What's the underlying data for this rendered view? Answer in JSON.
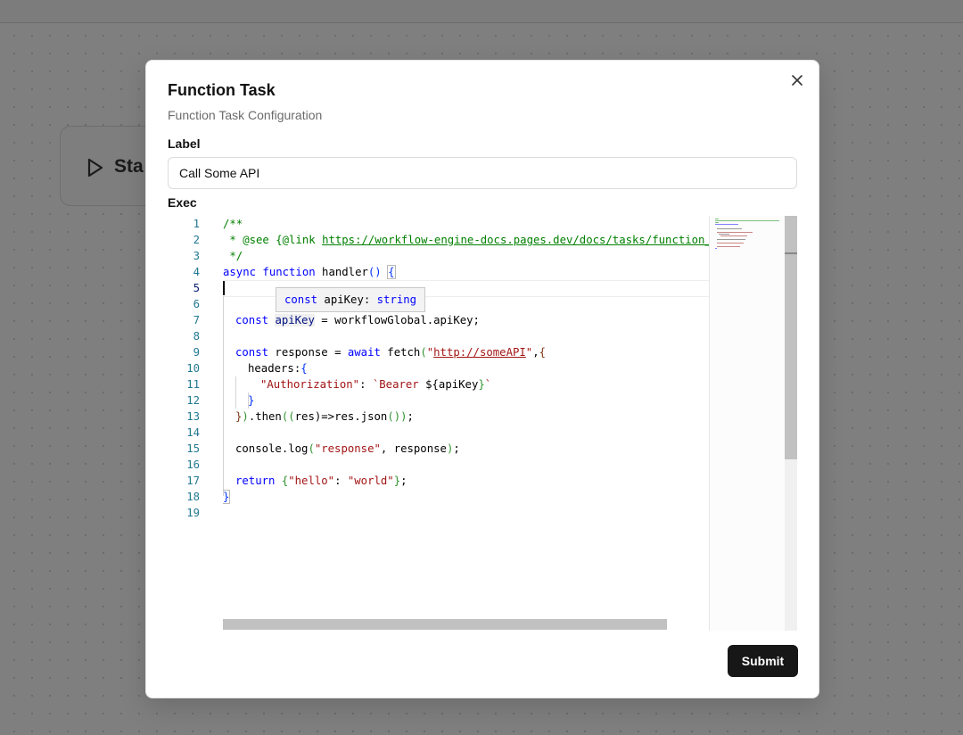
{
  "background_node": {
    "label": "Sta",
    "icon": "play-icon"
  },
  "dialog": {
    "title": "Function Task",
    "description": "Function Task Configuration",
    "label_field": {
      "label": "Label",
      "value": "Call Some API"
    },
    "exec_field": {
      "label": "Exec"
    },
    "submit_label": "Submit",
    "close_icon": "close-icon"
  },
  "editor": {
    "line_numbers": [
      "1",
      "2",
      "3",
      "4",
      "5",
      "6",
      "7",
      "8",
      "9",
      "10",
      "11",
      "12",
      "13",
      "14",
      "15",
      "16",
      "17",
      "18",
      "19"
    ],
    "active_line": "5",
    "hover_hint": {
      "prefix": "const ",
      "name": "apiKey",
      "sep": ": ",
      "type": "string"
    },
    "code": {
      "l1": "/**",
      "l2_a": " * @see {@link ",
      "l2_url": "https://workflow-engine-docs.pages.dev/docs/tasks/function_task",
      "l3": " */",
      "l4_kw": "async function",
      "l4_rest": " handler",
      "l4_paren": "()",
      "l4_brace": "{",
      "l7_kw": "const",
      "l7_var": "apiKey",
      "l7_rest": " = workflowGlobal.apiKey;",
      "l9_kw": "const",
      "l9_rest": " response = ",
      "l9_kw2": "await",
      "l9_fetch": " fetch",
      "l9_paren": "(",
      "l9_q1": "\"",
      "l9_url": "http://someAPI",
      "l9_q2": "\"",
      "l9_end": ",",
      "l9_brace": "{",
      "l10": "headers:",
      "l10_brace": "{",
      "l11_key": "\"Authorization\"",
      "l11_colon": ": ",
      "l11_tpl_a": "`Bearer ",
      "l11_dollar": "${",
      "l11_var": "apiKey",
      "l11_close": "}",
      "l11_tpl_b": "`",
      "l12_brace": "}",
      "l13_a": "}",
      "l13_b": ")",
      "l13_c": ".then",
      "l13_d": "((",
      "l13_e": "res",
      "l13_f": ")=>res.json",
      "l13_g": "())",
      "l13_h": ";",
      "l15_a": "console.log",
      "l15_b": "(",
      "l15_str": "\"response\"",
      "l15_c": ", response",
      "l15_d": ")",
      "l15_e": ";",
      "l17_kw": "return",
      "l17_brace": "{",
      "l17_k": "\"hello\"",
      "l17_colon": ": ",
      "l17_v": "\"world\"",
      "l17_close": "}",
      "l17_semi": ";",
      "l18": "}"
    }
  },
  "colors": {
    "primary_button": "#171717",
    "comment": "#008000",
    "keyword": "#0000ff",
    "string": "#a31515",
    "line_number": "#237893"
  }
}
